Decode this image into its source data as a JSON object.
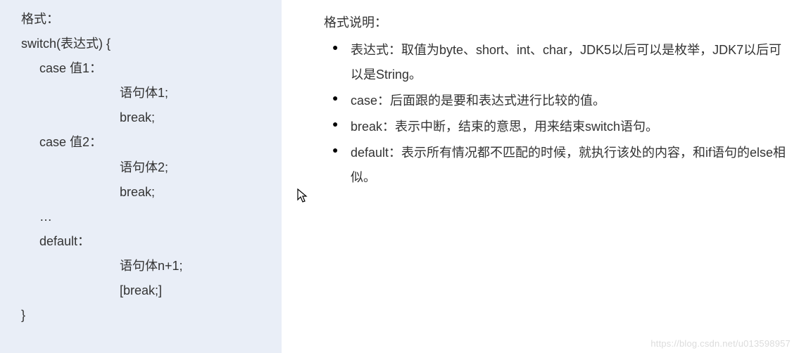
{
  "left": {
    "title": "格式：",
    "lines": [
      "switch(表达式) {",
      "case 值1：",
      "语句体1;",
      "break;",
      "case 值2：",
      "语句体2;",
      "break;",
      "…",
      "default：",
      "语句体n+1;",
      "[break;]",
      "}"
    ]
  },
  "right": {
    "title": "格式说明：",
    "items": [
      "表达式：取值为byte、short、int、char，JDK5以后可以是枚举，JDK7以后可以是String。",
      "case：后面跟的是要和表达式进行比较的值。",
      "break：表示中断，结束的意思，用来结束switch语句。",
      "default：表示所有情况都不匹配的时候，就执行该处的内容，和if语句的else相似。"
    ]
  },
  "watermark": "https://blog.csdn.net/u013598957"
}
